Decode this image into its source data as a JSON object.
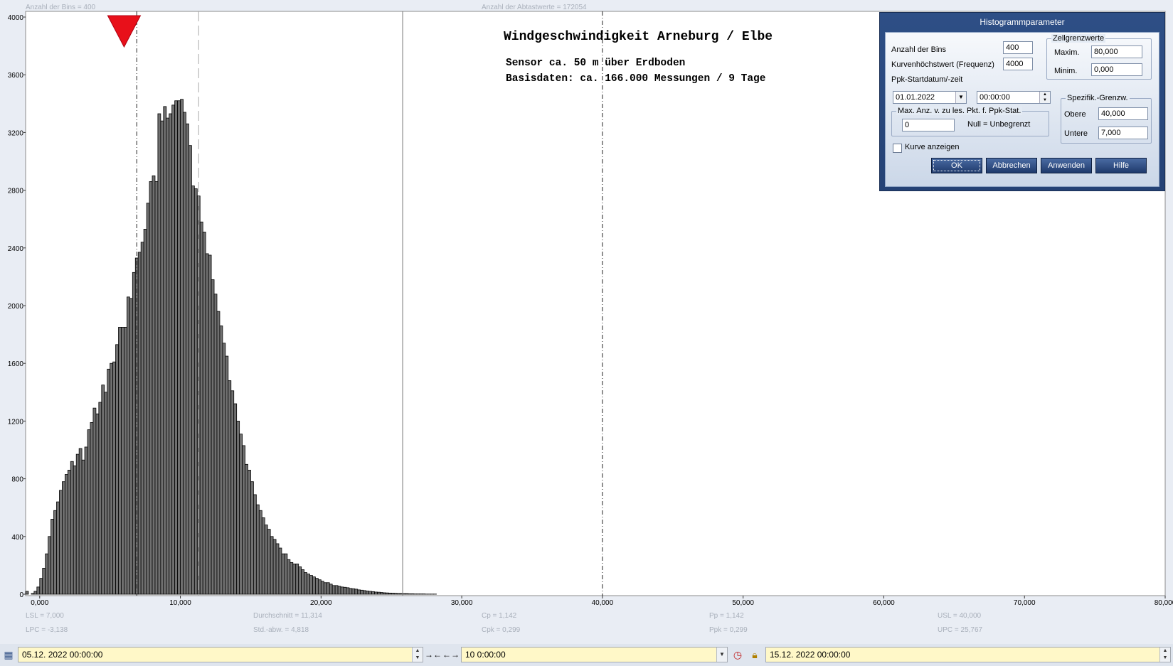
{
  "top_labels": {
    "bins": "Anzahl der Bins =   400",
    "samples": "Anzahl der Abtastwerte = 172054"
  },
  "chart_data": {
    "type": "bar",
    "title": "Windgeschwindigkeit  Arneburg / Elbe",
    "subtitle_1": "Sensor ca. 50 m über Erdboden",
    "subtitle_2": "Basisdaten:  ca. 166.000 Messungen / 9 Tage",
    "xlim": [
      -1,
      80
    ],
    "ylim": [
      0,
      4000
    ],
    "x_ticks": [
      "0,000",
      "10,000",
      "20,000",
      "30,000",
      "40,000",
      "50,000",
      "60,000",
      "70,000",
      "80,000"
    ],
    "y_ticks": [
      "0",
      "400",
      "800",
      "1200",
      "1600",
      "2000",
      "2400",
      "2800",
      "3200",
      "3600",
      "4000"
    ],
    "bin_width": 0.2,
    "bin_start": -1.0,
    "bar_color": "#707070",
    "bar_edge_color": "#000000",
    "counts": [
      20,
      0,
      5,
      20,
      50,
      110,
      180,
      280,
      400,
      520,
      580,
      640,
      720,
      780,
      830,
      860,
      920,
      890,
      970,
      1010,
      930,
      1020,
      1140,
      1190,
      1290,
      1250,
      1330,
      1450,
      1400,
      1560,
      1600,
      1610,
      1730,
      1850,
      1850,
      1850,
      2060,
      2050,
      2230,
      2330,
      2370,
      2440,
      2530,
      2710,
      2860,
      2900,
      2860,
      3330,
      3280,
      3380,
      3300,
      3330,
      3390,
      3420,
      3420,
      3430,
      3340,
      3260,
      3110,
      2830,
      2810,
      2760,
      2580,
      2510,
      2360,
      2350,
      2180,
      2080,
      1960,
      1860,
      1740,
      1650,
      1480,
      1410,
      1320,
      1200,
      1110,
      1030,
      900,
      860,
      780,
      690,
      620,
      580,
      530,
      480,
      450,
      400,
      380,
      350,
      320,
      280,
      280,
      240,
      220,
      210,
      210,
      190,
      170,
      150,
      140,
      130,
      120,
      110,
      100,
      90,
      80,
      80,
      70,
      60,
      60,
      55,
      50,
      48,
      45,
      40,
      38,
      35,
      30,
      28,
      25,
      22,
      20,
      18,
      15,
      14,
      12,
      10,
      9,
      8,
      7,
      6,
      5,
      5,
      4,
      4,
      3,
      3,
      2,
      2,
      2,
      2,
      1,
      1,
      1,
      1
    ],
    "vlines": [
      {
        "x": 6.9,
        "style": "dashdot",
        "name": "LSL"
      },
      {
        "x": 11.3,
        "style": "dash",
        "name": "mean"
      },
      {
        "x": 25.8,
        "style": "solid",
        "name": "UPC"
      },
      {
        "x": 40.0,
        "style": "dashdot",
        "name": "USL"
      }
    ],
    "marker": {
      "x": 6.0,
      "shape": "down-triangle",
      "color": "#e8101a"
    },
    "grid": false
  },
  "stats": {
    "lsl": "LSL = 7,000",
    "lpc": "LPC = -3,138",
    "avg": "Durchschnitt  = 11,314",
    "std": "Std.-abw. = 4,818",
    "cp": "Cp  = 1,142",
    "cpk": "Cpk = 0,299",
    "pp": "Pp  = 1,142",
    "ppk": "Ppk = 0,299",
    "usl": "USL = 40,000",
    "upc": "UPC = 25,767"
  },
  "dialog": {
    "title": "Histogrammparameter",
    "bins_label": "Anzahl der Bins",
    "bins_value": "400",
    "freq_label": "Kurvenhöchstwert (Frequenz)",
    "freq_value": "4000",
    "ppk_label": "Ppk-Startdatum/-zeit",
    "date_value": "01.01.2022",
    "time_value": "00:00:00",
    "maxpt_group": "Max. Anz. v. zu les. Pkt. f. Ppk-Stat.",
    "maxpt_value": "0",
    "null_label": "Null = Unbegrenzt",
    "curve_label": "Kurve anzeigen",
    "cell_group": "Zellgrenzwerte",
    "max_label": "Maxim.",
    "max_value": "80,000",
    "min_label": "Minim.",
    "min_value": "0,000",
    "spec_group": "Spezifik.-Grenzw.",
    "upper_label": "Obere",
    "upper_value": "40,000",
    "lower_label": "Untere",
    "lower_value": "7,000",
    "ok": "OK",
    "cancel": "Abbrechen",
    "apply": "Anwenden",
    "help": "Hilfe"
  },
  "bottom": {
    "start": "05.12. 2022   00:00:00",
    "duration": "10  0:00:00",
    "end": "15.12. 2022   00:00:00"
  },
  "icons": {
    "calendar": "calendar-icon",
    "clock": "clock-icon",
    "lock": "lock-icon"
  }
}
